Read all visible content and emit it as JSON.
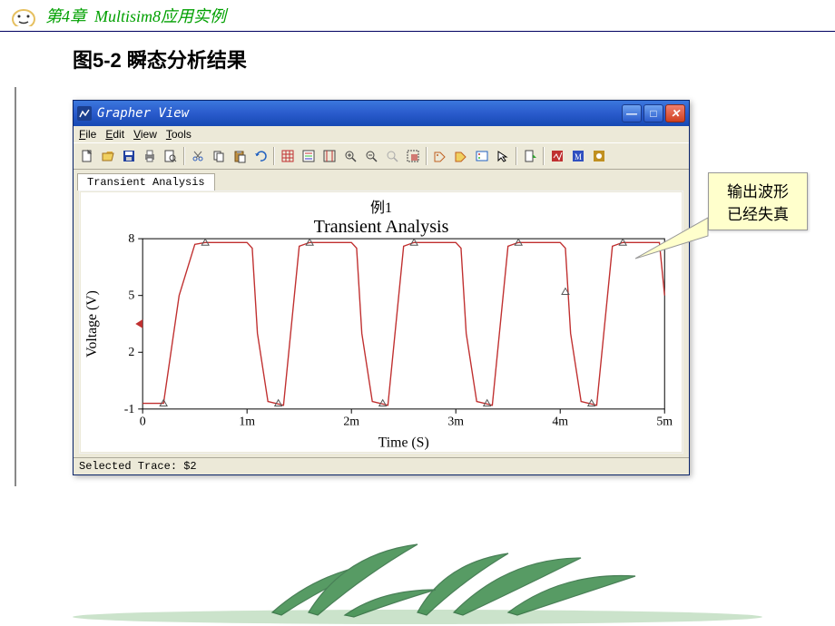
{
  "header": {
    "chapter": "第4章",
    "subject": "Multisim8应用实例"
  },
  "figure_caption": "图5-2 瞬态分析结果",
  "window": {
    "title": "Grapher View",
    "menu": {
      "file": "File",
      "edit": "Edit",
      "view": "View",
      "tools": "Tools"
    },
    "tab": "Transient Analysis",
    "plot_header1": "例1",
    "plot_header2": "Transient Analysis",
    "ylabel": "Voltage (V)",
    "xlabel": "Time (S)",
    "status": "Selected Trace: $2"
  },
  "callout": {
    "line1": "输出波形",
    "line2": "已经失真"
  },
  "chart_data": {
    "type": "line",
    "title": "Transient Analysis",
    "xlabel": "Time (S)",
    "ylabel": "Voltage (V)",
    "xlim": [
      0,
      0.005
    ],
    "ylim": [
      -1,
      8
    ],
    "xticks_labels": [
      "0",
      "1m",
      "2m",
      "3m",
      "4m",
      "5m"
    ],
    "yticks": [
      -1,
      2,
      5,
      8
    ],
    "series": [
      {
        "name": "$2",
        "color": "#c03030",
        "x": [
          0,
          0.0001,
          0.0002,
          0.00035,
          0.0005,
          0.0006,
          0.001,
          0.00105,
          0.0011,
          0.0012,
          0.00135,
          0.0015,
          0.0016,
          0.002,
          0.00205,
          0.0021,
          0.0022,
          0.00235,
          0.0025,
          0.0026,
          0.003,
          0.00305,
          0.0031,
          0.0032,
          0.00335,
          0.0035,
          0.0036,
          0.004,
          0.00405,
          0.0041,
          0.0042,
          0.00435,
          0.0045,
          0.0046,
          0.00495,
          0.005
        ],
        "y": [
          -0.7,
          -0.7,
          -0.7,
          5.0,
          7.7,
          7.8,
          7.8,
          7.5,
          3.0,
          -0.6,
          -0.8,
          7.6,
          7.8,
          7.8,
          7.5,
          3.0,
          -0.6,
          -0.8,
          7.6,
          7.8,
          7.8,
          7.5,
          3.0,
          -0.6,
          -0.8,
          7.6,
          7.8,
          7.8,
          7.5,
          3.0,
          -0.6,
          -0.8,
          7.6,
          7.8,
          7.8,
          5.0
        ]
      }
    ],
    "markers": [
      {
        "x": 0.0002,
        "y": -0.7
      },
      {
        "x": 0.0006,
        "y": 7.8
      },
      {
        "x": 0.0013,
        "y": -0.7
      },
      {
        "x": 0.0016,
        "y": 7.8
      },
      {
        "x": 0.0023,
        "y": -0.7
      },
      {
        "x": 0.0026,
        "y": 7.8
      },
      {
        "x": 0.0033,
        "y": -0.7
      },
      {
        "x": 0.0036,
        "y": 7.8
      },
      {
        "x": 0.00405,
        "y": 5.2
      },
      {
        "x": 0.0043,
        "y": -0.7
      },
      {
        "x": 0.0046,
        "y": 7.8
      }
    ]
  }
}
